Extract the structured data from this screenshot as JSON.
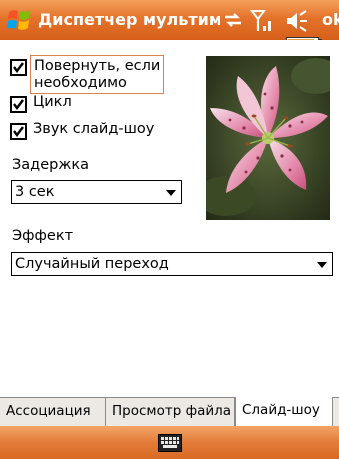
{
  "titlebar": {
    "title": "Диспетчер мультим",
    "ok_label": "ok"
  },
  "options": {
    "rotate_line1": "Повернуть, если",
    "rotate_line2": "необходимо",
    "rotate_checked": true,
    "loop_label": "Цикл",
    "loop_checked": true,
    "sound_label": "Звук слайд-шоу",
    "sound_checked": true
  },
  "delay": {
    "label": "Задержка",
    "value": "3 сек"
  },
  "effect": {
    "label": "Эффект",
    "value": "Случайный переход"
  },
  "tabs": [
    {
      "label": "Ассоциация",
      "active": false
    },
    {
      "label": "Просмотр файла",
      "active": false
    },
    {
      "label": "Слайд-шоу",
      "active": true
    }
  ],
  "icons": {
    "start": "windows-flag-icon",
    "connectivity": "connectivity-icon",
    "signal": "signal-icon",
    "volume": "volume-icon",
    "battery": "battery-icon",
    "keyboard": "keyboard-icon"
  },
  "colors": {
    "titlebar": "#e4732a",
    "menubar": "#e27b38"
  }
}
